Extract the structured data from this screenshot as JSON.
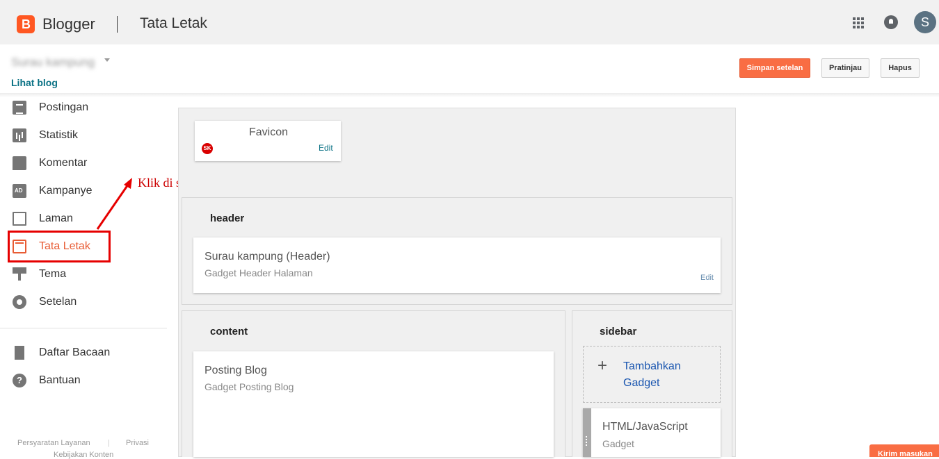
{
  "topbar": {
    "logo_letter": "B",
    "brand": "Blogger",
    "page_title": "Tata Letak",
    "avatar_initial": "S"
  },
  "blog": {
    "name": "Surau kampung",
    "view_link": "Lihat blog"
  },
  "actions": {
    "save": "Simpan setelan",
    "preview": "Pratinjau",
    "delete": "Hapus"
  },
  "sidebar": {
    "items": [
      {
        "label": "Postingan",
        "icon": "posts-icon"
      },
      {
        "label": "Statistik",
        "icon": "stats-icon"
      },
      {
        "label": "Komentar",
        "icon": "comment-icon"
      },
      {
        "label": "Kampanye",
        "icon": "ad-icon"
      },
      {
        "label": "Laman",
        "icon": "pages-icon"
      },
      {
        "label": "Tata Letak",
        "icon": "layout-icon",
        "active": true
      },
      {
        "label": "Tema",
        "icon": "paint-roller-icon"
      },
      {
        "label": "Setelan",
        "icon": "gear-icon"
      }
    ],
    "secondary": [
      {
        "label": "Daftar Bacaan",
        "icon": "bookmark-icon"
      },
      {
        "label": "Bantuan",
        "icon": "help-icon"
      }
    ],
    "footer": {
      "terms": "Persyaratan Layanan",
      "privacy": "Privasi",
      "content_policy": "Kebijakan Konten"
    }
  },
  "annotation": {
    "text": "Klik di sini"
  },
  "layout": {
    "favicon": {
      "title": "Favicon",
      "badge": "SK",
      "edit": "Edit"
    },
    "header": {
      "title": "header",
      "gadget_title": "Surau kampung (Header)",
      "gadget_sub": "Gadget Header Halaman",
      "edit": "Edit"
    },
    "content": {
      "title": "content",
      "gadget_title": "Posting Blog",
      "gadget_sub": "Gadget Posting Blog"
    },
    "sidebar": {
      "title": "sidebar",
      "add_plus": "+",
      "add_label": "Tambahkan Gadget",
      "gadget_title": "HTML/JavaScript",
      "gadget_sub": "Gadget"
    }
  },
  "feedback": "Kirim masukan",
  "colors": {
    "accent": "#f96d43",
    "active": "#e85c34",
    "link": "#0b7285",
    "annotation": "#e60000"
  }
}
